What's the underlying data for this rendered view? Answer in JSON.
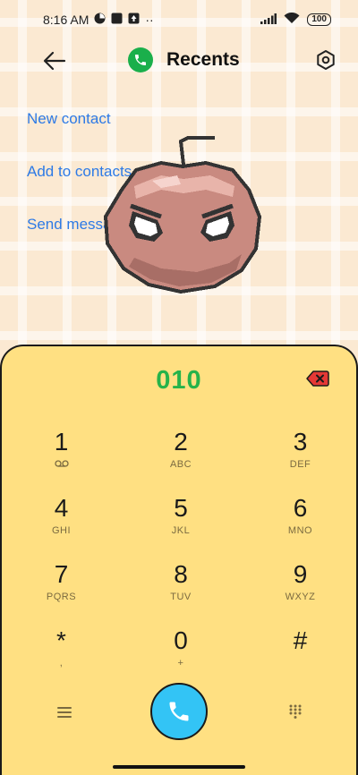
{
  "status_bar": {
    "time": "8:16 AM",
    "more": "··",
    "battery": "100"
  },
  "app_bar": {
    "title": "Recents"
  },
  "menu": {
    "items": [
      "New contact",
      "Add to contacts",
      "Send message"
    ]
  },
  "dialer": {
    "number": "010",
    "keys": [
      {
        "digit": "1",
        "letters": ""
      },
      {
        "digit": "2",
        "letters": "ABC"
      },
      {
        "digit": "3",
        "letters": "DEF"
      },
      {
        "digit": "4",
        "letters": "GHI"
      },
      {
        "digit": "5",
        "letters": "JKL"
      },
      {
        "digit": "6",
        "letters": "MNO"
      },
      {
        "digit": "7",
        "letters": "PQRS"
      },
      {
        "digit": "8",
        "letters": "TUV"
      },
      {
        "digit": "9",
        "letters": "WXYZ"
      },
      {
        "digit": "*",
        "letters": ","
      },
      {
        "digit": "0",
        "letters": "+"
      },
      {
        "digit": "#",
        "letters": ""
      }
    ]
  },
  "colors": {
    "accent_green": "#26b34a",
    "link_blue": "#2d7ae6",
    "keypad_bg": "#ffe082",
    "call_blue": "#33c4f5",
    "backspace_red": "#e53935"
  }
}
